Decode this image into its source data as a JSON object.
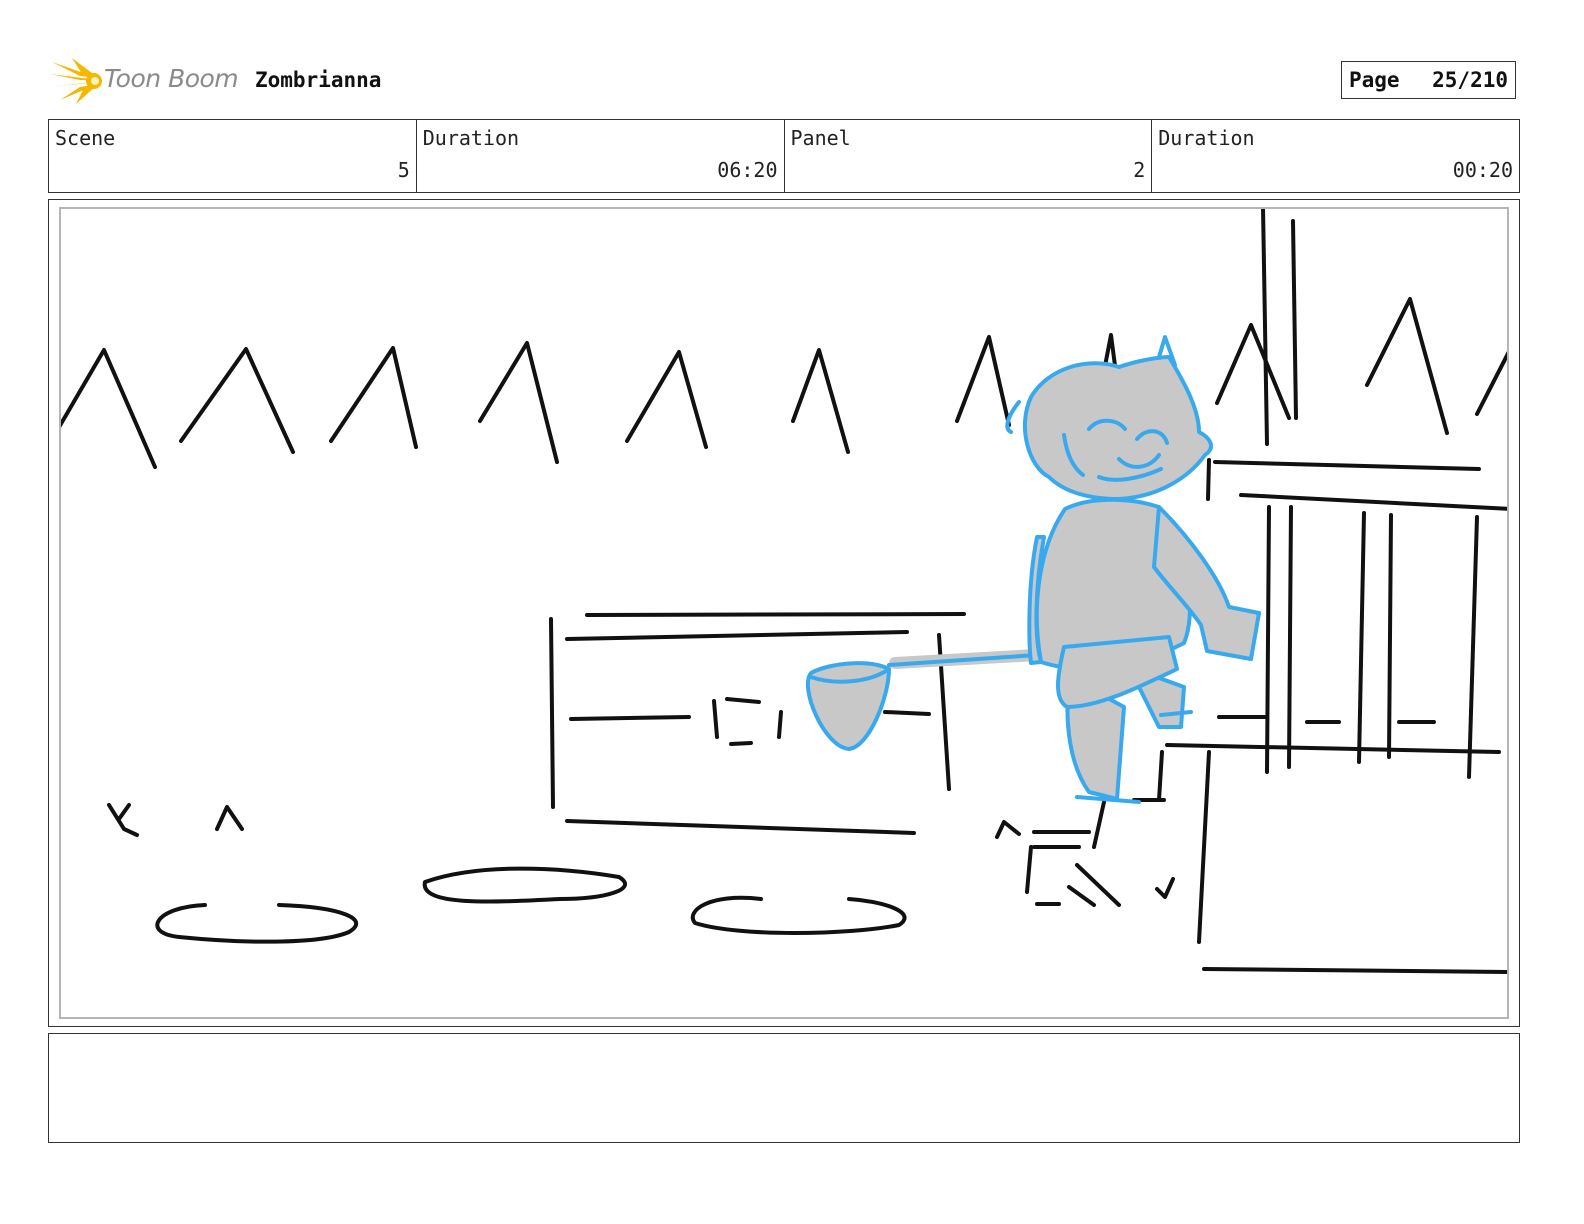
{
  "header": {
    "logo_text": "Toon Boom",
    "project_title": "Zombrianna",
    "page_label": "Page",
    "page_value": "25/210"
  },
  "info": [
    {
      "label": "Scene",
      "value": "5"
    },
    {
      "label": "Duration",
      "value": "06:20"
    },
    {
      "label": "Panel",
      "value": "2"
    },
    {
      "label": "Duration",
      "value": "00:20"
    }
  ],
  "notes": {
    "text": ""
  },
  "colors": {
    "sketch_line": "#111111",
    "character_line": "#39a9ee",
    "character_fill": "#c8c8c8",
    "logo_accent": "#f5b800"
  }
}
